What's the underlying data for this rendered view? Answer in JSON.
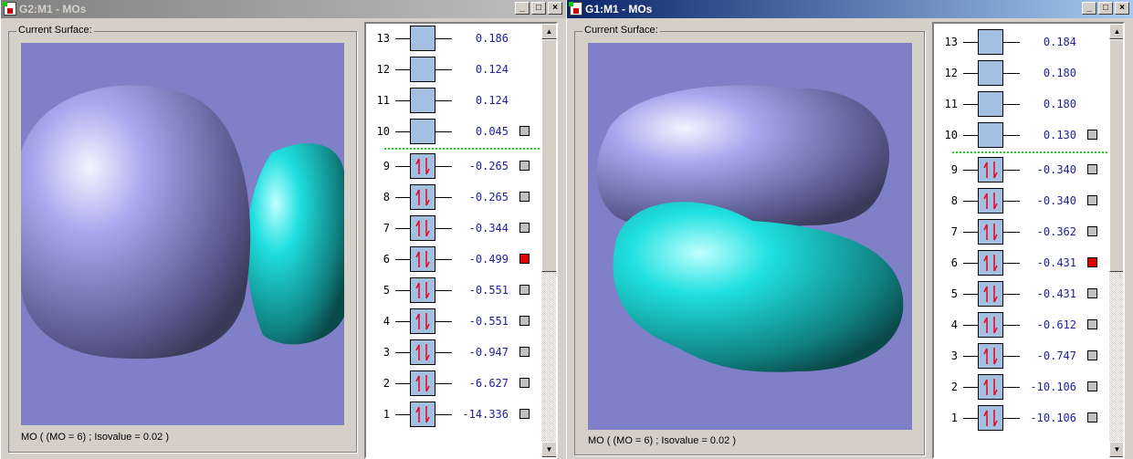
{
  "windows": [
    {
      "title": "G2:M1 - MOs",
      "group_label": "Current Surface:",
      "status": "MO ( (MO = 6) ; Isovalue = 0.02 )",
      "orbitals": [
        {
          "n": "13",
          "energy": "0.186",
          "occupied": false,
          "selector": false
        },
        {
          "n": "12",
          "energy": "0.124",
          "occupied": false,
          "selector": false
        },
        {
          "n": "11",
          "energy": "0.124",
          "occupied": false,
          "selector": false
        },
        {
          "n": "10",
          "energy": "0.045",
          "occupied": false,
          "selector": true
        },
        {
          "n": "9",
          "energy": "-0.265",
          "occupied": true,
          "selector": true
        },
        {
          "n": "8",
          "energy": "-0.265",
          "occupied": true,
          "selector": true
        },
        {
          "n": "7",
          "energy": "-0.344",
          "occupied": true,
          "selector": true
        },
        {
          "n": "6",
          "energy": "-0.499",
          "occupied": true,
          "selector": true,
          "selected": true
        },
        {
          "n": "5",
          "energy": "-0.551",
          "occupied": true,
          "selector": true
        },
        {
          "n": "4",
          "energy": "-0.551",
          "occupied": true,
          "selector": true
        },
        {
          "n": "3",
          "energy": "-0.947",
          "occupied": true,
          "selector": true
        },
        {
          "n": "2",
          "energy": "-6.627",
          "occupied": true,
          "selector": true
        },
        {
          "n": "1",
          "energy": "-14.336",
          "occupied": true,
          "selector": true
        }
      ]
    },
    {
      "title": "G1:M1 - MOs",
      "group_label": "Current Surface:",
      "status": "MO ( (MO = 6) ; Isovalue = 0.02 )",
      "orbitals": [
        {
          "n": "13",
          "energy": "0.184",
          "occupied": false,
          "selector": false
        },
        {
          "n": "12",
          "energy": "0.180",
          "occupied": false,
          "selector": false
        },
        {
          "n": "11",
          "energy": "0.180",
          "occupied": false,
          "selector": false
        },
        {
          "n": "10",
          "energy": "0.130",
          "occupied": false,
          "selector": true
        },
        {
          "n": "9",
          "energy": "-0.340",
          "occupied": true,
          "selector": true
        },
        {
          "n": "8",
          "energy": "-0.340",
          "occupied": true,
          "selector": true
        },
        {
          "n": "7",
          "energy": "-0.362",
          "occupied": true,
          "selector": true
        },
        {
          "n": "6",
          "energy": "-0.431",
          "occupied": true,
          "selector": true,
          "selected": true
        },
        {
          "n": "5",
          "energy": "-0.431",
          "occupied": true,
          "selector": true
        },
        {
          "n": "4",
          "energy": "-0.612",
          "occupied": true,
          "selector": true
        },
        {
          "n": "3",
          "energy": "-0.747",
          "occupied": true,
          "selector": true
        },
        {
          "n": "2",
          "energy": "-10.106",
          "occupied": true,
          "selector": true
        },
        {
          "n": "1",
          "energy": "-10.106",
          "occupied": true,
          "selector": true
        }
      ]
    }
  ],
  "colors": {
    "positive_lobe": "#a0a0f0",
    "negative_lobe": "#20e0e0",
    "homo_lumo_line": "#20d020",
    "selected": "#e00000"
  }
}
